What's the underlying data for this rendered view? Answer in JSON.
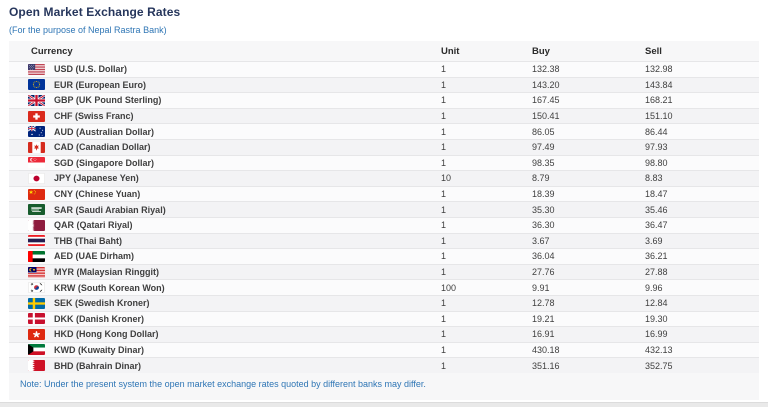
{
  "page": {
    "title": "Open Market Exchange Rates",
    "subtitle": "(For the purpose of Nepal Rastra Bank)",
    "note": "Note: Under the present system the open market exchange rates quoted by different banks may differ."
  },
  "colors": {
    "title_navy": "#26365c",
    "link_blue": "#2f76b5",
    "panel_bg": "#f7f7f8",
    "header_text": "#2b2b2b",
    "row_text": "#3f3f3f",
    "row_border": "#e6e6e8",
    "footer_gray": "#e9e9e9"
  },
  "table": {
    "columns": [
      "Currency",
      "Unit",
      "Buy",
      "Sell"
    ],
    "rows": [
      {
        "code": "USD",
        "label": "USD (U.S. Dollar)",
        "flag": "usd-flag-icon",
        "unit": "1",
        "buy": "132.38",
        "sell": "132.98"
      },
      {
        "code": "EUR",
        "label": "EUR (European Euro)",
        "flag": "eur-flag-icon",
        "unit": "1",
        "buy": "143.20",
        "sell": "143.84"
      },
      {
        "code": "GBP",
        "label": "GBP (UK Pound Sterling)",
        "flag": "gbp-flag-icon",
        "unit": "1",
        "buy": "167.45",
        "sell": "168.21"
      },
      {
        "code": "CHF",
        "label": "CHF (Swiss Franc)",
        "flag": "chf-flag-icon",
        "unit": "1",
        "buy": "150.41",
        "sell": "151.10"
      },
      {
        "code": "AUD",
        "label": "AUD (Australian Dollar)",
        "flag": "aud-flag-icon",
        "unit": "1",
        "buy": "86.05",
        "sell": "86.44"
      },
      {
        "code": "CAD",
        "label": "CAD (Canadian Dollar)",
        "flag": "cad-flag-icon",
        "unit": "1",
        "buy": "97.49",
        "sell": "97.93"
      },
      {
        "code": "SGD",
        "label": "SGD (Singapore Dollar)",
        "flag": "sgd-flag-icon",
        "unit": "1",
        "buy": "98.35",
        "sell": "98.80"
      },
      {
        "code": "JPY",
        "label": "JPY (Japanese Yen)",
        "flag": "jpy-flag-icon",
        "unit": "10",
        "buy": "8.79",
        "sell": "8.83"
      },
      {
        "code": "CNY",
        "label": "CNY (Chinese Yuan)",
        "flag": "cny-flag-icon",
        "unit": "1",
        "buy": "18.39",
        "sell": "18.47"
      },
      {
        "code": "SAR",
        "label": "SAR (Saudi Arabian Riyal)",
        "flag": "sar-flag-icon",
        "unit": "1",
        "buy": "35.30",
        "sell": "35.46"
      },
      {
        "code": "QAR",
        "label": "QAR (Qatari Riyal)",
        "flag": "qar-flag-icon",
        "unit": "1",
        "buy": "36.30",
        "sell": "36.47"
      },
      {
        "code": "THB",
        "label": "THB (Thai Baht)",
        "flag": "thb-flag-icon",
        "unit": "1",
        "buy": "3.67",
        "sell": "3.69"
      },
      {
        "code": "AED",
        "label": "AED (UAE Dirham)",
        "flag": "aed-flag-icon",
        "unit": "1",
        "buy": "36.04",
        "sell": "36.21"
      },
      {
        "code": "MYR",
        "label": "MYR (Malaysian Ringgit)",
        "flag": "myr-flag-icon",
        "unit": "1",
        "buy": "27.76",
        "sell": "27.88"
      },
      {
        "code": "KRW",
        "label": "KRW (South Korean Won)",
        "flag": "krw-flag-icon",
        "unit": "100",
        "buy": "9.91",
        "sell": "9.96"
      },
      {
        "code": "SEK",
        "label": "SEK (Swedish Kroner)",
        "flag": "sek-flag-icon",
        "unit": "1",
        "buy": "12.78",
        "sell": "12.84"
      },
      {
        "code": "DKK",
        "label": "DKK (Danish Kroner)",
        "flag": "dkk-flag-icon",
        "unit": "1",
        "buy": "19.21",
        "sell": "19.30"
      },
      {
        "code": "HKD",
        "label": "HKD (Hong Kong Dollar)",
        "flag": "hkd-flag-icon",
        "unit": "1",
        "buy": "16.91",
        "sell": "16.99"
      },
      {
        "code": "KWD",
        "label": "KWD (Kuwaity Dinar)",
        "flag": "kwd-flag-icon",
        "unit": "1",
        "buy": "430.18",
        "sell": "432.13"
      },
      {
        "code": "BHD",
        "label": "BHD (Bahrain Dinar)",
        "flag": "bhd-flag-icon",
        "unit": "1",
        "buy": "351.16",
        "sell": "352.75"
      }
    ]
  }
}
